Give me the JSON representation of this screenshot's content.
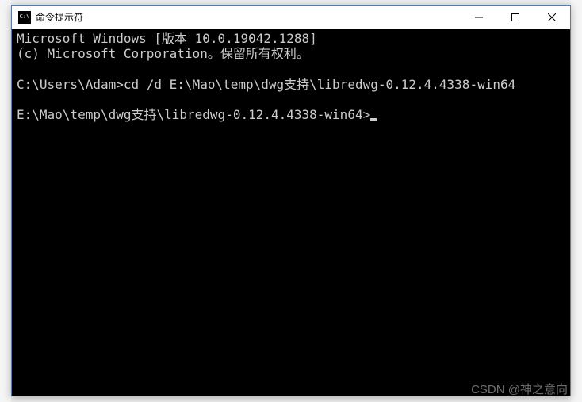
{
  "window": {
    "title": "命令提示符"
  },
  "terminal": {
    "line1": "Microsoft Windows [版本 10.0.19042.1288]",
    "line2": "(c) Microsoft Corporation。保留所有权利。",
    "line3": "",
    "prompt1": "C:\\Users\\Adam>",
    "command1": "cd /d E:\\Mao\\temp\\dwg支持\\libredwg-0.12.4.4338-win64",
    "line5": "",
    "prompt2": "E:\\Mao\\temp\\dwg支持\\libredwg-0.12.4.4338-win64>"
  },
  "watermark": "CSDN @神之意向"
}
